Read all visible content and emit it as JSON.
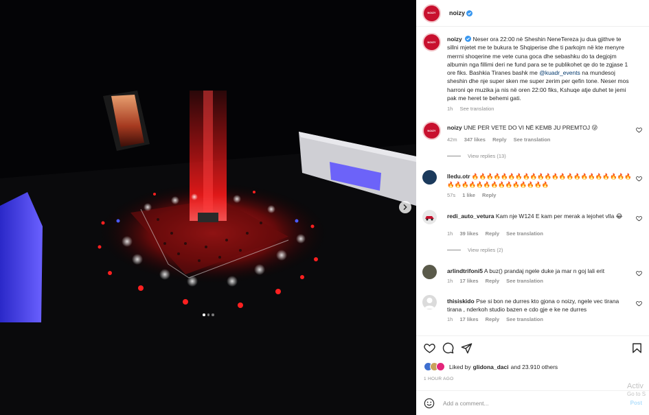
{
  "post": {
    "username": "noizy",
    "avatar_text": "NOIZY",
    "caption": "Neser ora 22:00 në Sheshin NeneTereza ju dua gjithve te sillni mjetet me te bukura te Shqiperise dhe ti parkojm në kte menyre merrni shoqerine me vete cuna goca dhe sebashku do ta degjojm albumin nga fillimi deri ne fund para se te publikohet qe do te zgjase 1 ore fiks. Bashkia Tiranes bashk me",
    "caption_mention": "@kuadr_events",
    "caption_end": "na mundesoj sheshin dhe nje super sken me super zerim per qefin tone. Neser mos harroni qe muzika ja nis në oren 22:00 fiks, Kshuqe atje duhet te jemi pak me heret te behemi gati.",
    "caption_time": "1h",
    "see_translation": "See translation"
  },
  "comments": [
    {
      "user": "noizy",
      "text": "UNE PER VETE DO VI NË KEMB JU PREMTOJ 😜",
      "time": "42m",
      "likes": "347 likes",
      "reply": "Reply",
      "translation": "See translation",
      "view_replies": "View replies (13)"
    },
    {
      "user": "lledu.otr",
      "text": "🔥🔥🔥🔥🔥🔥🔥🔥🔥🔥🔥🔥🔥🔥🔥🔥🔥🔥🔥🔥🔥🔥🔥🔥🔥🔥🔥🔥🔥🔥🔥🔥🔥🔥🔥🔥",
      "time": "57s",
      "likes": "1 like",
      "reply": "Reply"
    },
    {
      "user": "redi_auto_vetura",
      "text": "Kam nje W124 E kam per merak a lejohet vlla 😂",
      "time": "1h",
      "likes": "39 likes",
      "reply": "Reply",
      "translation": "See translation",
      "view_replies": "View replies (2)"
    },
    {
      "user": "arlindtrifoni5",
      "text": "A buz() prandaj ngele duke ja mar n goj lali erit",
      "time": "1h",
      "likes": "17 likes",
      "reply": "Reply",
      "translation": "See translation"
    },
    {
      "user": "thisiskido",
      "text": "Pse si bon ne durres kto gjona o noizy, ngele vec tirana tirana , nderkoh studio bazen e cdo gje e ke ne durres",
      "time": "1h",
      "likes": "17 likes",
      "reply": "Reply",
      "translation": "See translation"
    }
  ],
  "likes": {
    "prefix": "Liked by",
    "user": "glidona_daci",
    "suffix": "and 23.910 others"
  },
  "time_ago": "1 HOUR AGO",
  "add_comment": {
    "placeholder": "Add a comment...",
    "post": "Post"
  },
  "watermark": {
    "line1": "Activ",
    "line2": "Go to S"
  },
  "colors": {
    "brand_red": "#c8102e",
    "link": "#00376b",
    "meta": "#8e8e8e"
  }
}
